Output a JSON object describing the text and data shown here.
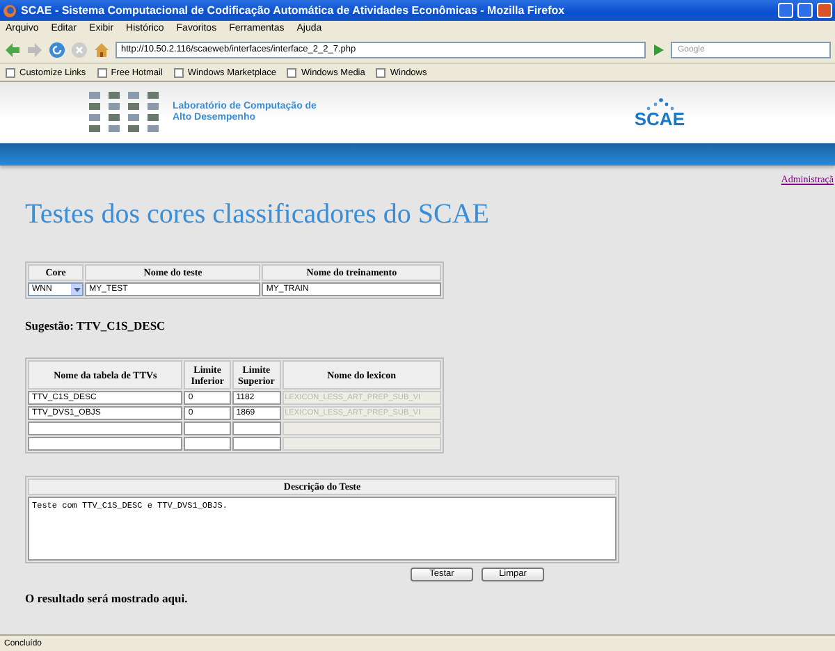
{
  "window": {
    "title": "SCAE - Sistema Computacional de Codificação Automática de Atividades Econômicas - Mozilla Firefox"
  },
  "menu": [
    "Arquivo",
    "Editar",
    "Exibir",
    "Histórico",
    "Favoritos",
    "Ferramentas",
    "Ajuda"
  ],
  "toolbar": {
    "url": "http://10.50.2.116/scaeweb/interfaces/interface_2_2_7.php",
    "search_placeholder": "Google"
  },
  "bookmarks": [
    "Customize Links",
    "Free Hotmail",
    "Windows Marketplace",
    "Windows Media",
    "Windows"
  ],
  "header": {
    "lab_name": "Laboratório de Computação de Alto Desempenho",
    "logo_text": "SCAE"
  },
  "admin_link": "Administraçã",
  "heading": "Testes dos cores classificadores do SCAE",
  "test_form": {
    "columns": [
      "Core",
      "Nome do teste",
      "Nome do treinamento"
    ],
    "core": "WNN",
    "test_name": "MY_TEST",
    "training_name": "MY_TRAIN"
  },
  "suggestion": "Sugestão: TTV_C1S_DESC",
  "ttv_table": {
    "columns": [
      "Nome da tabela de TTVs",
      "Limite Inferior",
      "Limite Superior",
      "Nome do lexicon"
    ],
    "rows": [
      {
        "name": "TTV_C1S_DESC",
        "lower": "0",
        "upper": "1182",
        "lexicon": "LEXICON_LESS_ART_PREP_SUB_VI",
        "lexicon_disabled": true
      },
      {
        "name": "TTV_DVS1_OBJS",
        "lower": "0",
        "upper": "1869",
        "lexicon": "LEXICON_LESS_ART_PREP_SUB_VI",
        "lexicon_disabled": true
      },
      {
        "lexicon_disabled": true
      },
      {
        "lexicon_disabled": true
      }
    ]
  },
  "description": {
    "label": "Descrição do Teste",
    "text": "Teste com TTV_C1S_DESC e TTV_DVS1_OBJS."
  },
  "buttons": [
    "Testar",
    "Limpar"
  ],
  "result": "O resultado será mostrado aqui.",
  "status_bar": "Concluído"
}
